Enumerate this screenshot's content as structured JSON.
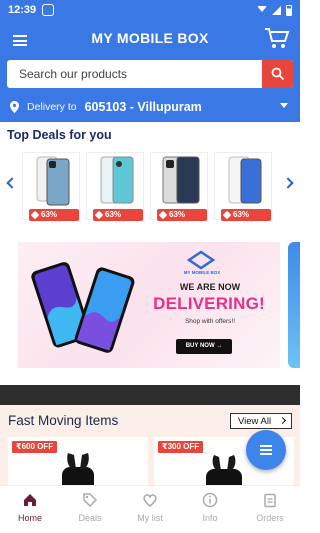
{
  "status_bar": {
    "time": "12:39"
  },
  "header": {
    "title": "MY MOBILE BOX",
    "search_placeholder": "Search our products",
    "delivery_label": "Delivery to",
    "delivery_location": "605103 - Villupuram"
  },
  "top_deals": {
    "title": "Top Deals for you",
    "items": [
      {
        "discount": "63% OFF"
      },
      {
        "discount": "63% OFF"
      },
      {
        "discount": "63% OFF"
      },
      {
        "discount": "63% OFF"
      }
    ]
  },
  "banner": {
    "brand_text": "MY MOBILE BOX",
    "headline": "WE ARE NOW",
    "highlight": "DELIVERING!",
    "subtext": "Shop with offers!!",
    "cta": "BUY NOW →"
  },
  "fast_moving": {
    "title": "Fast Moving Items",
    "view_all": "View All",
    "items": [
      {
        "discount": "₹600 OFF"
      },
      {
        "discount": "₹300 OFF"
      }
    ]
  },
  "bottom_nav": {
    "items": [
      {
        "label": "Home"
      },
      {
        "label": "Deals"
      },
      {
        "label": "My list"
      },
      {
        "label": "Info"
      },
      {
        "label": "Orders"
      }
    ]
  },
  "colors": {
    "primary": "#3a78e6",
    "accent": "#e8453c",
    "active_nav": "#6a1e3a"
  }
}
